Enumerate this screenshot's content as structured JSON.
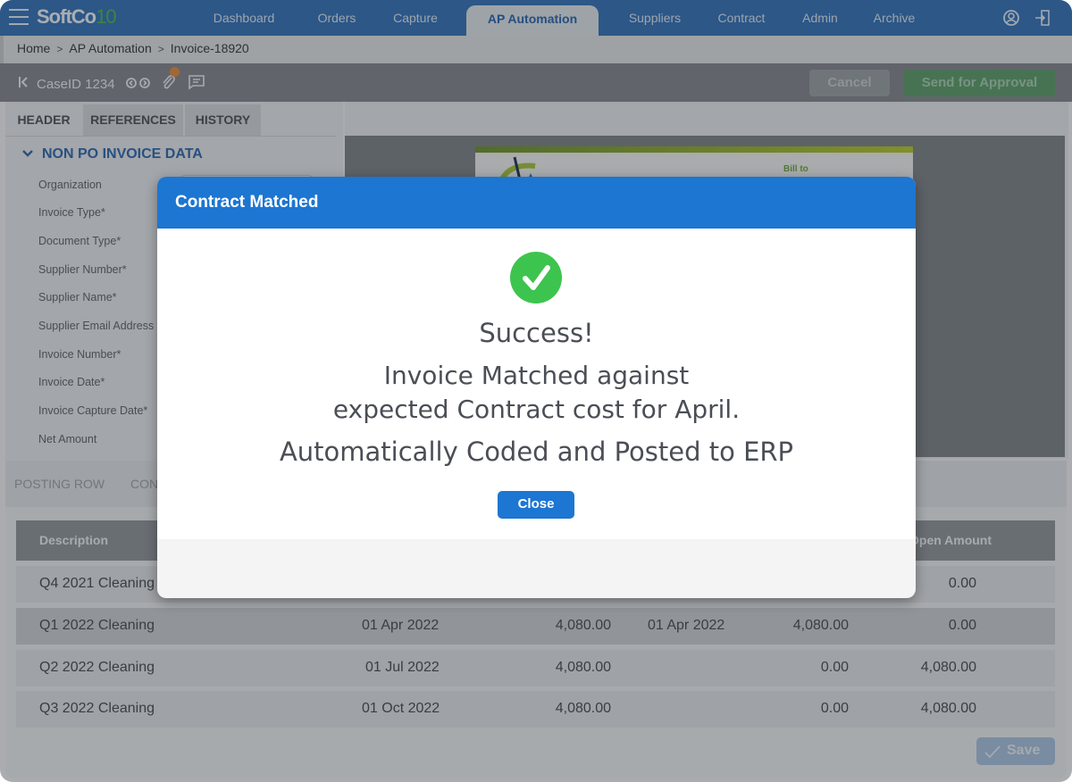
{
  "app": {
    "logo_main": "SoftCo",
    "logo_version": "10"
  },
  "nav": {
    "items": [
      {
        "label": "Dashboard"
      },
      {
        "label": "Orders"
      },
      {
        "label": "Capture"
      },
      {
        "label": "AP Automation",
        "active": true
      },
      {
        "label": "Suppliers"
      },
      {
        "label": "Contract"
      },
      {
        "label": "Admin"
      },
      {
        "label": "Archive"
      }
    ],
    "icons": [
      "user-profile-icon",
      "logout-icon"
    ]
  },
  "breadcrumb": {
    "items": [
      "Home",
      "AP Automation",
      "Invoice-18920"
    ],
    "separator": ">"
  },
  "toolbar": {
    "case_id": "CaseID 1234",
    "cancel_label": "Cancel",
    "send_label": "Send for Approval",
    "attachment_badge_color": "#e8883a"
  },
  "left_panel": {
    "tabs": [
      "HEADER",
      "REFERENCES",
      "HISTORY"
    ],
    "section_title": "NON PO INVOICE DATA",
    "fields": [
      "Organization",
      "Invoice Type*",
      "Document Type*",
      "Supplier Number*",
      "Supplier Name*",
      "Supplier Email Address",
      "Invoice Number*",
      "Invoice Date*",
      "Invoice Capture Date*",
      "Net Amount"
    ]
  },
  "document": {
    "bill_to_label": "Bill to"
  },
  "lower_panel": {
    "tabs": [
      "POSTING ROW",
      "CON"
    ],
    "table": {
      "headers": [
        "Description",
        "Open Amount"
      ],
      "rows": [
        {
          "description": "Q4 2021 Cleaning",
          "date": "",
          "amount": "",
          "matched_date": "",
          "matched_amount": "",
          "open_amount": "0.00"
        },
        {
          "description": "Q1 2022 Cleaning",
          "date": "01 Apr 2022",
          "amount": "4,080.00",
          "matched_date": "01 Apr 2022",
          "matched_amount": "4,080.00",
          "open_amount": "0.00"
        },
        {
          "description": "Q2 2022 Cleaning",
          "date": "01 Jul 2022",
          "amount": "4,080.00",
          "matched_date": "",
          "matched_amount": "0.00",
          "open_amount": "4,080.00"
        },
        {
          "description": "Q3 2022 Cleaning",
          "date": "01 Oct 2022",
          "amount": "4,080.00",
          "matched_date": "",
          "matched_amount": "0.00",
          "open_amount": "4,080.00"
        }
      ]
    },
    "save_label": "Save"
  },
  "modal": {
    "title": "Contract Matched",
    "success": "Success!",
    "line1": "Invoice Matched against",
    "line2": "expected Contract cost for April.",
    "line3": "Automatically Coded and Posted to ERP",
    "close_label": "Close",
    "header_color": "#1c76d2",
    "check_color": "#3dc44e"
  }
}
